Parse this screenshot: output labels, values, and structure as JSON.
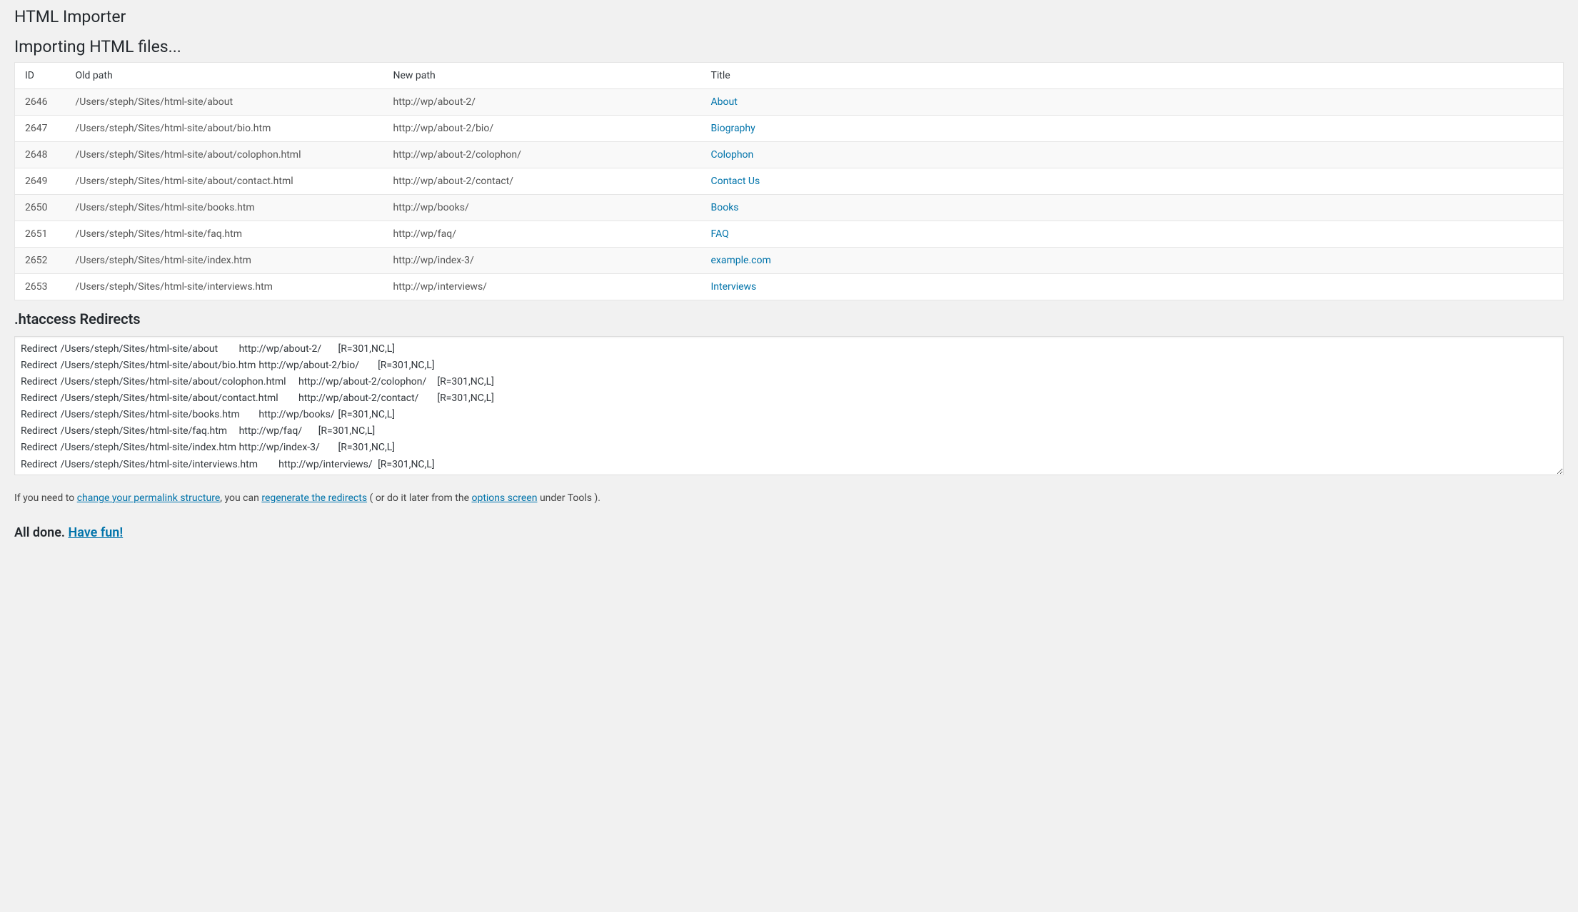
{
  "page_title": "HTML Importer",
  "subtitle": "Importing HTML files...",
  "table": {
    "columns": {
      "id": "ID",
      "old_path": "Old path",
      "new_path": "New path",
      "title": "Title"
    },
    "rows": [
      {
        "id": "2646",
        "old_path": "/Users/steph/Sites/html-site/about",
        "new_path": "http://wp/about-2/",
        "title": "About"
      },
      {
        "id": "2647",
        "old_path": "/Users/steph/Sites/html-site/about/bio.htm",
        "new_path": "http://wp/about-2/bio/",
        "title": "Biography"
      },
      {
        "id": "2648",
        "old_path": "/Users/steph/Sites/html-site/about/colophon.html",
        "new_path": "http://wp/about-2/colophon/",
        "title": "Colophon"
      },
      {
        "id": "2649",
        "old_path": "/Users/steph/Sites/html-site/about/contact.html",
        "new_path": "http://wp/about-2/contact/",
        "title": "Contact Us"
      },
      {
        "id": "2650",
        "old_path": "/Users/steph/Sites/html-site/books.htm",
        "new_path": "http://wp/books/",
        "title": "Books"
      },
      {
        "id": "2651",
        "old_path": "/Users/steph/Sites/html-site/faq.htm",
        "new_path": "http://wp/faq/",
        "title": "FAQ"
      },
      {
        "id": "2652",
        "old_path": "/Users/steph/Sites/html-site/index.htm",
        "new_path": "http://wp/index-3/",
        "title": "example.com"
      },
      {
        "id": "2653",
        "old_path": "/Users/steph/Sites/html-site/interviews.htm",
        "new_path": "http://wp/interviews/",
        "title": "Interviews"
      }
    ]
  },
  "redirects_heading": ".htaccess Redirects",
  "redirects_text": "Redirect\t/Users/steph/Sites/html-site/about\thttp://wp/about-2/\t[R=301,NC,L]\nRedirect\t/Users/steph/Sites/html-site/about/bio.htm\thttp://wp/about-2/bio/\t[R=301,NC,L]\nRedirect\t/Users/steph/Sites/html-site/about/colophon.html\thttp://wp/about-2/colophon/\t[R=301,NC,L]\nRedirect\t/Users/steph/Sites/html-site/about/contact.html\thttp://wp/about-2/contact/\t[R=301,NC,L]\nRedirect\t/Users/steph/Sites/html-site/books.htm\thttp://wp/books/\t[R=301,NC,L]\nRedirect\t/Users/steph/Sites/html-site/faq.htm\thttp://wp/faq/\t[R=301,NC,L]\nRedirect\t/Users/steph/Sites/html-site/index.htm\thttp://wp/index-3/\t[R=301,NC,L]\nRedirect\t/Users/steph/Sites/html-site/interviews.htm\thttp://wp/interviews/\t[R=301,NC,L]",
  "footer": {
    "prefix": "If you need to ",
    "link1": "change your permalink structure",
    "middle1": ", you can ",
    "link2": "regenerate the redirects",
    "middle2": " ( or do it later from the ",
    "link3": "options screen",
    "suffix": " under Tools )."
  },
  "done": {
    "prefix": "All done. ",
    "link": "Have fun!"
  }
}
